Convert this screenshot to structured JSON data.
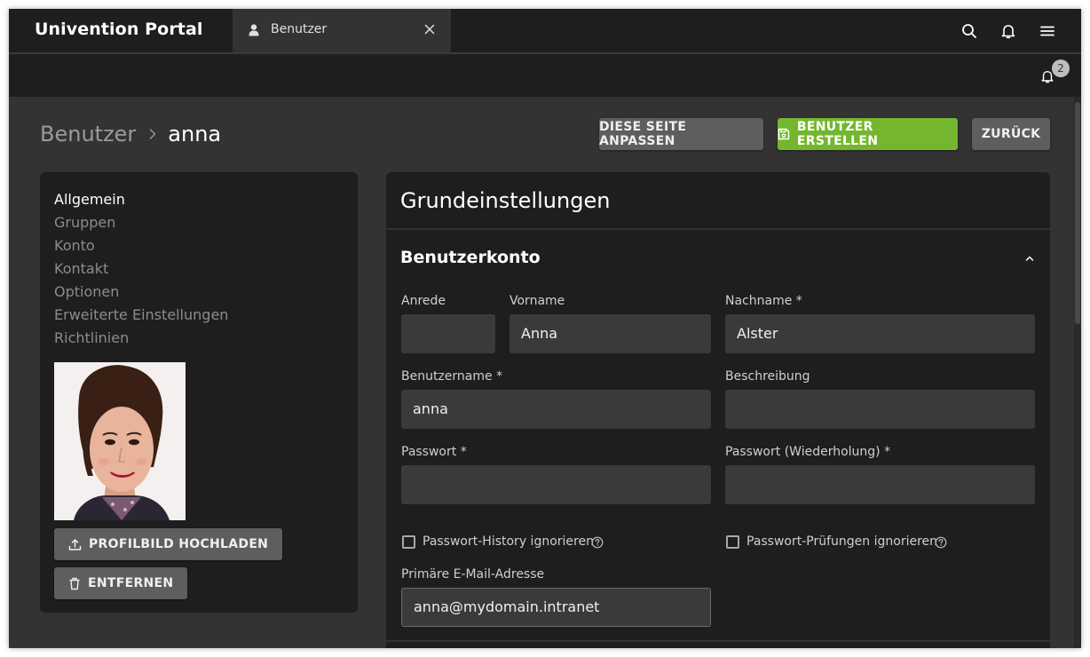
{
  "app": {
    "title": "Univention Portal"
  },
  "tab": {
    "label": "Benutzer",
    "icon": "user-icon",
    "close_icon": "close-icon"
  },
  "header_icons": [
    "search-icon",
    "bell-icon",
    "menu-icon"
  ],
  "notifications": {
    "count": "2"
  },
  "breadcrumb": {
    "parent": "Benutzer",
    "current": "anna"
  },
  "actions": {
    "customize": "DIESE SEITE ANPASSEN",
    "create": "BENUTZER ERSTELLEN",
    "back": "ZURÜCK"
  },
  "sidebar": {
    "items": [
      {
        "label": "Allgemein",
        "active": true
      },
      {
        "label": "Gruppen"
      },
      {
        "label": "Konto"
      },
      {
        "label": "Kontakt"
      },
      {
        "label": "Optionen"
      },
      {
        "label": "Erweiterte Einstellungen"
      },
      {
        "label": "Richtlinien"
      }
    ],
    "upload_label": "PROFILBILD HOCHLADEN",
    "remove_label": "ENTFERNEN"
  },
  "panel": {
    "title": "Grundeinstellungen",
    "section": "Benutzerkonto",
    "fields": {
      "anrede": {
        "label": "Anrede",
        "value": ""
      },
      "vorname": {
        "label": "Vorname",
        "value": "Anna"
      },
      "nachname": {
        "label": "Nachname *",
        "value": "Alster"
      },
      "benutzername": {
        "label": "Benutzername *",
        "value": "anna"
      },
      "beschreibung": {
        "label": "Beschreibung",
        "value": ""
      },
      "passwort": {
        "label": "Passwort *",
        "value": ""
      },
      "passwort2": {
        "label": "Passwort (Wiederholung) *",
        "value": ""
      },
      "email": {
        "label": "Primäre E-Mail-Adresse",
        "value": "anna@mydomain.intranet"
      }
    },
    "checkboxes": {
      "history": {
        "label": "Passwort-History ignorieren",
        "checked": false
      },
      "checks": {
        "label": "Passwort-Prüfungen ignorieren",
        "checked": false
      }
    }
  },
  "colors": {
    "accent_green": "#74b72e",
    "header_bg": "#1e1e1e",
    "content_bg": "#333333",
    "button_grey": "#5e5e5e"
  }
}
